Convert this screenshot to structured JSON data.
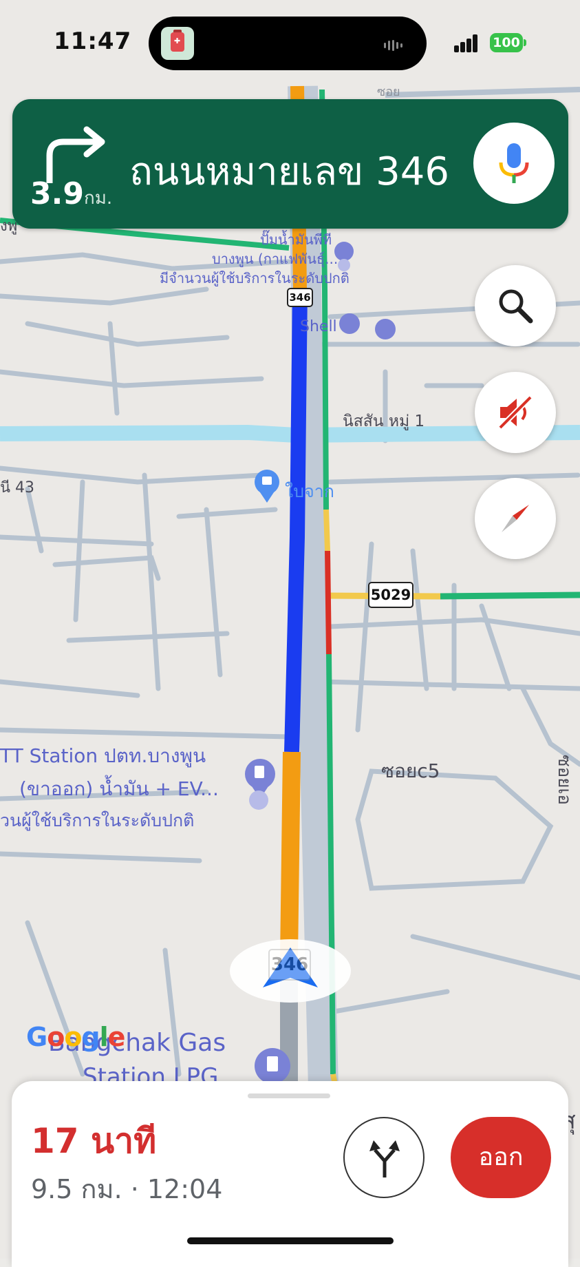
{
  "status_bar": {
    "time": "11:47",
    "battery": "100"
  },
  "navigation": {
    "turn_direction": "turn-right",
    "distance_value": "3.9",
    "distance_unit": "กม.",
    "street_name": "ถนนหมายเลข 346"
  },
  "map": {
    "road_shields": {
      "route_346_top": "346",
      "route_5029": "5029",
      "route_346_bottom": "346"
    },
    "labels": {
      "road_top_right": "ซอย",
      "road_left_top": "งพู",
      "nissan": "นิสสัน หมู่ 1",
      "road_43": "นี 43",
      "soi_c5": "ซอยc5",
      "soi_vertical": "ซอยเอ",
      "right_edge": "สุ"
    },
    "pois": {
      "gas_top_line1": "ปั๊มน้ำมันพีที",
      "gas_top_line2": "บางพูน (กาแฟพันธุ์...",
      "gas_top_line3": "มีจำนวนผู้ใช้บริการในระดับปกติ",
      "shell": "Shell",
      "baijak": "ใบจาก",
      "ptt_line1": "TT Station ปตท.บางพูน",
      "ptt_line2": "(ขาออก) น้ำมัน + EV...",
      "ptt_line3": "วนผู้ใช้บริการในระดับปกติ",
      "bangchak_line1": "Bangchak Gas",
      "bangchak_line2": "Station LPG"
    }
  },
  "eta": {
    "duration": "17 นาที",
    "distance_and_arrival": "9.5 กม. · 12:04"
  },
  "buttons": {
    "exit_label": "ออก"
  },
  "colors": {
    "banner_green": "#0e6045",
    "route_blue": "#1a3cf0",
    "traffic_orange": "#f39c12",
    "traffic_red": "#d93025",
    "traffic_green": "#22b573",
    "exit_red": "#d72f2a",
    "eta_red": "#d32f2f"
  },
  "icons": [
    "turn-right-arrow",
    "microphone",
    "search",
    "sound-muted",
    "compass",
    "alternate-routes",
    "navigation-arrow"
  ]
}
